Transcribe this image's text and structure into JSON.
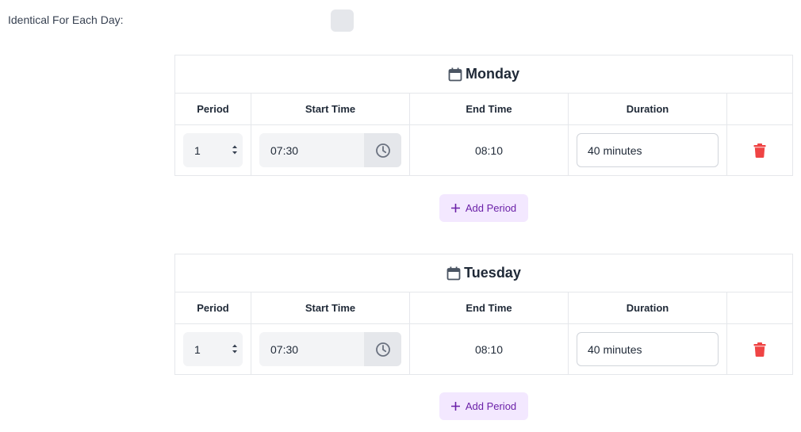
{
  "settings": {
    "identical_label": "Identical For Each Day:"
  },
  "headers": {
    "period": "Period",
    "start_time": "Start Time",
    "end_time": "End Time",
    "duration": "Duration"
  },
  "days": [
    {
      "name": "Monday",
      "rows": [
        {
          "period": "1",
          "start_time": "07:30",
          "end_time": "08:10",
          "duration": "40 minutes"
        }
      ],
      "add_label": "Add Period"
    },
    {
      "name": "Tuesday",
      "rows": [
        {
          "period": "1",
          "start_time": "07:30",
          "end_time": "08:10",
          "duration": "40 minutes"
        }
      ],
      "add_label": "Add Period"
    }
  ],
  "colors": {
    "accent_text": "#6b21a8",
    "accent_bg": "#f3e8ff",
    "danger": "#ef4444"
  }
}
